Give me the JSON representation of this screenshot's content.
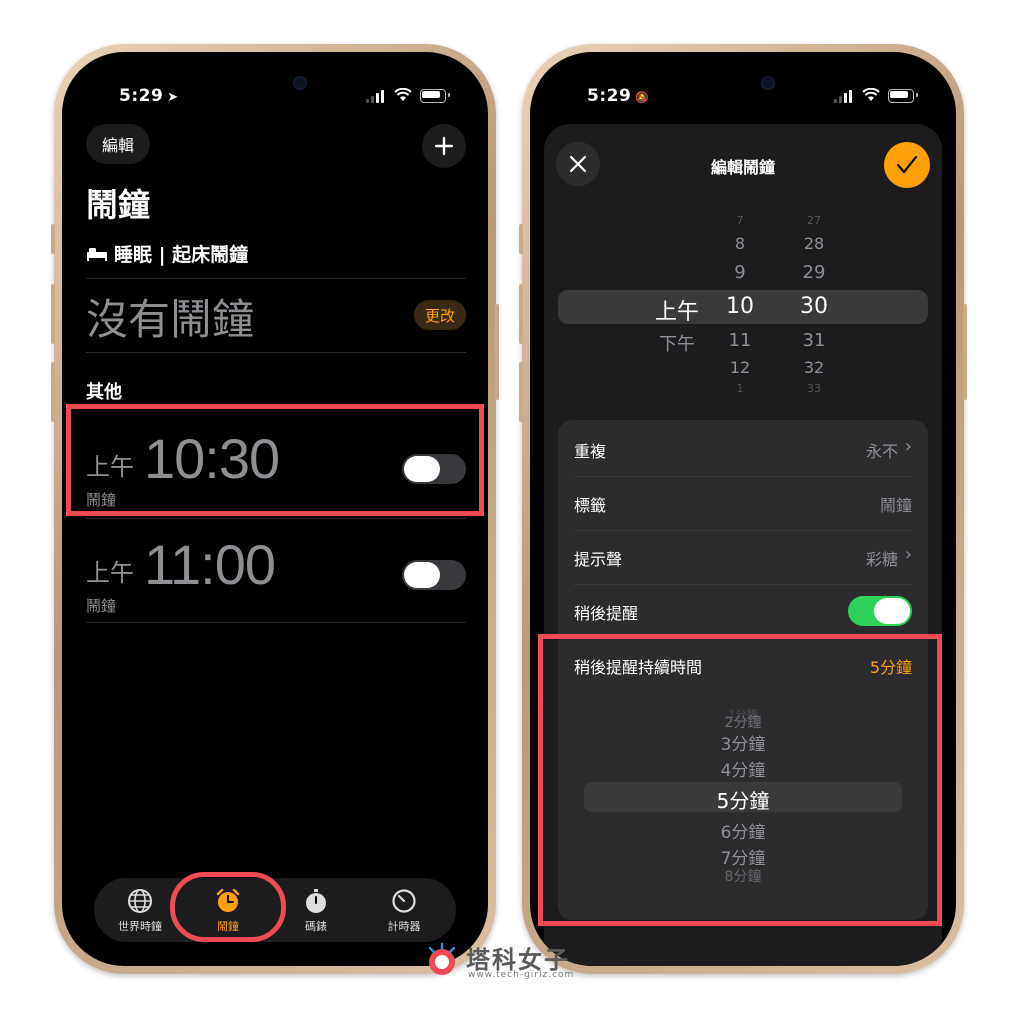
{
  "status_left": {
    "time": "5:29",
    "glyph": "➤"
  },
  "status_right": {
    "time": "5:29",
    "glyph": "🔕"
  },
  "left": {
    "edit_label": "編輯",
    "title": "鬧鐘",
    "sleep_label": "睡眠 | 起床鬧鐘",
    "no_alarm": "沒有鬧鐘",
    "change_label": "更改",
    "section_other": "其他",
    "alarms": [
      {
        "ampm": "上午",
        "time": "10:30",
        "label": "鬧鐘",
        "enabled": false
      },
      {
        "ampm": "上午",
        "time": "11:00",
        "label": "鬧鐘",
        "enabled": false
      }
    ],
    "tabs": [
      {
        "label": "世界時鐘",
        "icon": "globe-icon"
      },
      {
        "label": "鬧鐘",
        "icon": "alarm-clock-icon",
        "active": true
      },
      {
        "label": "碼錶",
        "icon": "stopwatch-icon"
      },
      {
        "label": "計時器",
        "icon": "timer-icon"
      }
    ]
  },
  "right": {
    "title": "編輯鬧鐘",
    "picker": {
      "ampm": [
        "上午",
        "下午"
      ],
      "hours": [
        "7",
        "8",
        "9",
        "10",
        "11",
        "12",
        "1"
      ],
      "minutes": [
        "27",
        "28",
        "29",
        "30",
        "31",
        "32",
        "33"
      ],
      "selected_ampm": "上午",
      "selected_hour": "10",
      "selected_minute": "30"
    },
    "rows": {
      "repeat": {
        "label": "重複",
        "value": "永不"
      },
      "tag": {
        "label": "標籤",
        "value": "鬧鐘"
      },
      "sound": {
        "label": "提示聲",
        "value": "彩糖"
      },
      "snooze": {
        "label": "稍後提醒",
        "enabled": true
      },
      "snooze_duration": {
        "label": "稍後提醒持續時間",
        "value": "5分鐘"
      }
    },
    "snooze_options": [
      "1分鐘",
      "2分鐘",
      "3分鐘",
      "4分鐘",
      "5分鐘",
      "6分鐘",
      "7分鐘",
      "8分鐘"
    ],
    "snooze_selected": "5分鐘"
  },
  "watermark": {
    "main": "塔科女子",
    "sub": "www.tech-girlz.com"
  },
  "colors": {
    "accent": "#ff9f0a",
    "highlight": "#ef4b55",
    "toggle_on": "#30d158"
  }
}
